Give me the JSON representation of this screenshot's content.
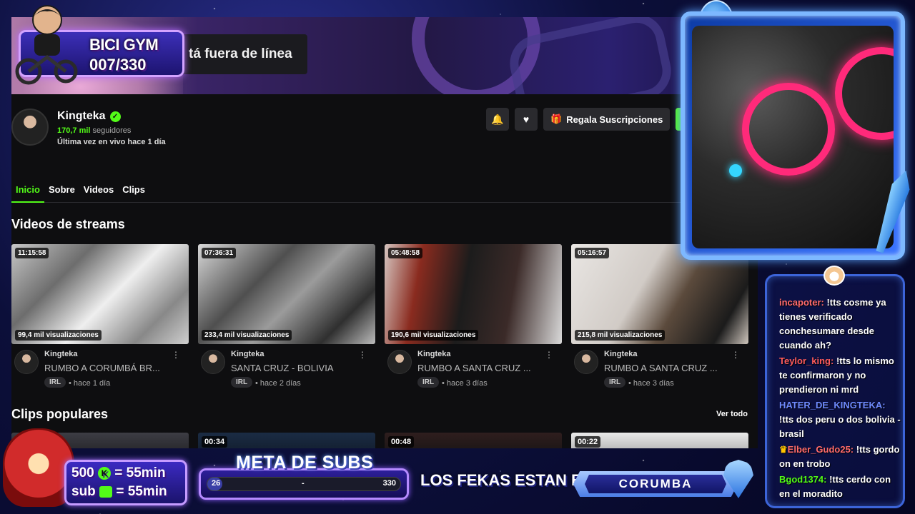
{
  "page": {
    "offline_text": "tá fuera de línea",
    "channel": {
      "name": "Kingteka",
      "followers_num": "170,7 mil",
      "followers_label": "seguidores",
      "last_live": "Última vez en vivo hace 1 día",
      "gift_label": "Regala Suscripciones"
    },
    "tabs": [
      "Inicio",
      "Sobre",
      "Videos",
      "Clips"
    ],
    "streams_title": "Videos de streams",
    "videos": [
      {
        "duration": "11:15:58",
        "views": "99,4 mil visualizaciones",
        "author": "Kingteka",
        "title": "RUMBO A CORUMBÁ BR...",
        "tag": "IRL",
        "ago": "• hace 1 día"
      },
      {
        "duration": "07:36:31",
        "views": "233,4 mil visualizaciones",
        "author": "Kingteka",
        "title": "SANTA CRUZ - BOLIVIA",
        "tag": "IRL",
        "ago": "• hace 2 días"
      },
      {
        "duration": "05:48:58",
        "views": "190,6 mil visualizaciones",
        "author": "Kingteka",
        "title": "RUMBO A SANTA CRUZ ...",
        "tag": "IRL",
        "ago": "• hace 3 días"
      },
      {
        "duration": "05:16:57",
        "views": "215,8 mil visualizaciones",
        "author": "Kingteka",
        "title": "RUMBO A SANTA CRUZ ...",
        "tag": "IRL",
        "ago": "• hace 3 días"
      }
    ],
    "clips_title": "Clips populares",
    "see_all": "Ver todo",
    "clips": [
      {
        "duration": ""
      },
      {
        "duration": "00:34"
      },
      {
        "duration": "00:48"
      },
      {
        "duration": "00:22"
      }
    ]
  },
  "overlay": {
    "bici_title": "BICI GYM",
    "bici_count": "007/330",
    "sr_line1_amount": "500",
    "sr_line1_value": "= 55min",
    "sr_line2_label": "sub",
    "sr_line2_value": "= 55min",
    "meta_title": "META DE SUBS",
    "meta_start": "26",
    "meta_sep": "-",
    "meta_end": "330",
    "meta_progress_fraction": 0.079,
    "fekas_label": "LOS FEKAS ESTAN EN:",
    "location": "CORUMBA"
  },
  "chat": [
    {
      "user": "incapoter:",
      "color": "#ff6b6b",
      "text": " !tts cosme ya tienes verificado conchesumare desde cuando ah?"
    },
    {
      "user": "Teylor_king:",
      "color": "#ff5c5c",
      "text": " !tts lo mismo te confirmaron y no prendieron ni mrd"
    },
    {
      "user": "HATER_DE_KINGTEKA:",
      "color": "#6f8bff",
      "text": " !tts dos peru o dos bolivia - brasil"
    },
    {
      "user": "Elber_Gudo25:",
      "color": "#ff6b6b",
      "text": " !tts gordo on en trobo"
    },
    {
      "user": "Bgod1374:",
      "color": "#53fc18",
      "text": " !tts cerdo con en el moradito"
    }
  ],
  "colors": {
    "accent": "#53fc18",
    "page_bg": "#0e0e10"
  },
  "icons": [
    "verified-icon",
    "bell-icon",
    "heart-icon",
    "gift-icon",
    "more-vertical-icon",
    "kick-icon",
    "potion-icon",
    "sword-icon",
    "hamster-icon",
    "pin-icon"
  ]
}
